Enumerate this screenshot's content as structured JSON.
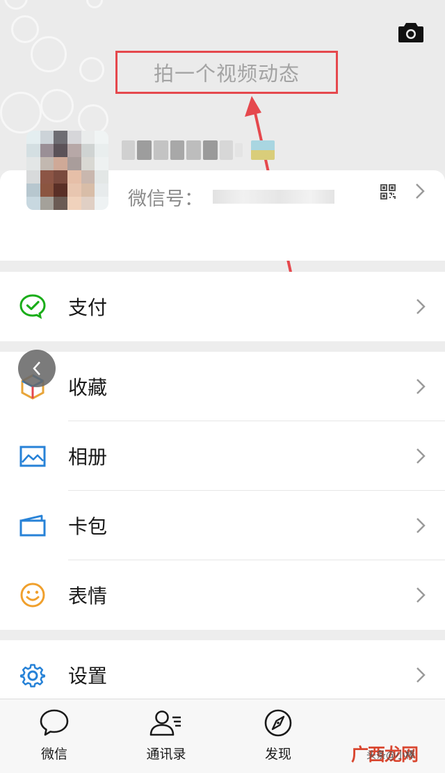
{
  "header": {
    "status_prompt": "拍一个视频动态",
    "camera_icon": "camera-icon"
  },
  "profile": {
    "nickname": "",
    "wechat_id_label": "微信号：",
    "wechat_id_value": "",
    "qr_icon": "qr-code-icon"
  },
  "menu": {
    "pay": "支付",
    "favorites": "收藏",
    "album": "相册",
    "cards": "卡包",
    "stickers": "表情",
    "settings": "设置"
  },
  "tabs": [
    {
      "label": "微信",
      "icon": "chat-bubble-icon"
    },
    {
      "label": "通讯录",
      "icon": "contacts-icon"
    },
    {
      "label": "发现",
      "icon": "compass-icon"
    }
  ],
  "watermark": {
    "text": "广西龙网",
    "small_text": "头条@小棒"
  },
  "colors": {
    "pay_green": "#1aad19",
    "album_blue": "#2782d7",
    "stickers_orange": "#f0a02d",
    "annotation_red": "#e5484d"
  }
}
